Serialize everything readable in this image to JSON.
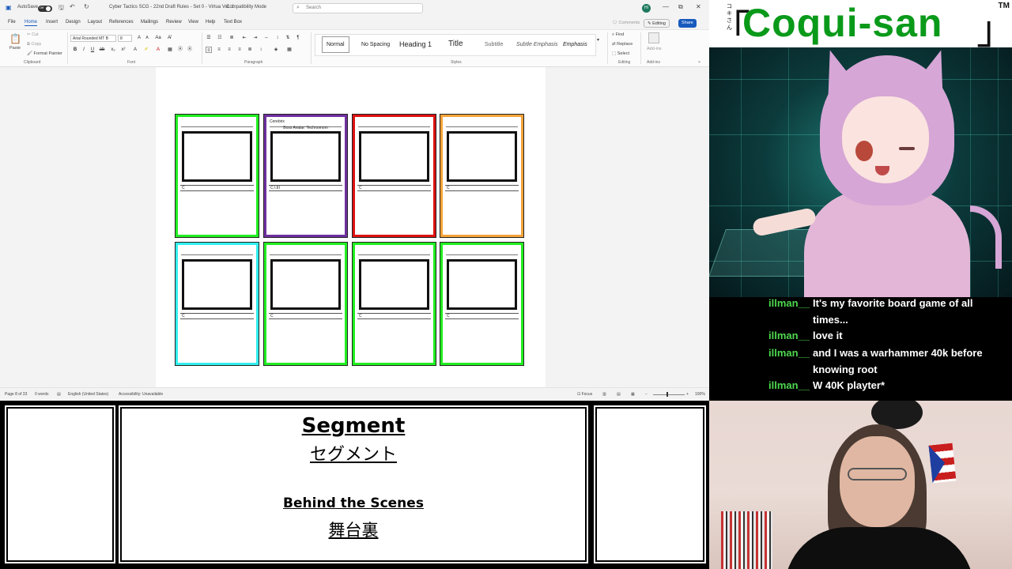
{
  "word": {
    "titlebar": {
      "autosave_label": "AutoSave",
      "autosave_state": "Off",
      "doc_title": "Cyber Tactics SCG - 22nd Draft Rules - Set 0 - Virtua Vol. 1",
      "compat": "Compatibility Mode",
      "search_placeholder": "Search",
      "user_initials": "HI",
      "minimize": "—",
      "restore": "⧉",
      "close": "✕"
    },
    "menu": [
      "File",
      "Home",
      "Insert",
      "Design",
      "Layout",
      "References",
      "Mailings",
      "Review",
      "View",
      "Help",
      "Text Box"
    ],
    "comments_label": "Comments",
    "editing_label": "Editing",
    "share_label": "Share",
    "ribbon": {
      "paste": "Paste",
      "cut": "Cut",
      "copy": "Copy",
      "format_painter": "Format Painter",
      "clipboard": "Clipboard",
      "font_name": "Arial Rounded MT B",
      "font_size": "8",
      "font_group": "Font",
      "paragraph_group": "Paragraph",
      "styles_group": "Styles",
      "editing_group": "Editing",
      "addins_group": "Add-ins",
      "find": "Find",
      "replace": "Replace",
      "select": "Select",
      "addins": "Add-ins",
      "styles": [
        "Normal",
        "No Spacing",
        "Heading 1",
        "Title",
        "Subtitle",
        "Subtle Emphasis",
        "Emphasis"
      ]
    },
    "cards": [
      {
        "color": "#22ee22",
        "name": "",
        "type": "",
        "cost": "C",
        "foot": ""
      },
      {
        "color": "#7030a0",
        "name": "Cerebrix",
        "type": "Boss Avatar: Technomom",
        "cost": "C:\\:III",
        "foot": ""
      },
      {
        "color": "#dd1111",
        "name": "",
        "type": "",
        "cost": "C",
        "foot": ""
      },
      {
        "color": "#f5a33a",
        "name": "",
        "type": "",
        "cost": "C",
        "foot": ""
      },
      {
        "color": "#33eeee",
        "name": "",
        "type": "",
        "cost": "C",
        "foot": ""
      },
      {
        "color": "#22ee22",
        "name": "",
        "type": "",
        "cost": "C",
        "foot": ""
      },
      {
        "color": "#22ee22",
        "name": "",
        "type": "",
        "cost": "C",
        "foot": ""
      },
      {
        "color": "#22ee22",
        "name": "",
        "type": "",
        "cost": "C",
        "foot": ""
      }
    ],
    "status": {
      "page": "Page 8 of 33",
      "words": "0 words",
      "language": "English (United States)",
      "accessibility": "Accessibility: Unavailable",
      "focus": "Focus",
      "zoom": "100%"
    }
  },
  "brand": {
    "title": "Coqui-san",
    "kana": "コキさん",
    "tm": "TM"
  },
  "chat": [
    {
      "user": "illman__",
      "msg": "It's my favorite board game of all times..."
    },
    {
      "user": "illman__",
      "msg": "love it"
    },
    {
      "user": "illman__",
      "msg": "and I was a warhammer 40k before knowing root"
    },
    {
      "user": "illman__",
      "msg": "W 40K playter*"
    }
  ],
  "segment": {
    "title": "Segment",
    "title_jp": "セグメント",
    "subtitle": "Behind the Scenes",
    "subtitle_jp": "舞台裏"
  }
}
